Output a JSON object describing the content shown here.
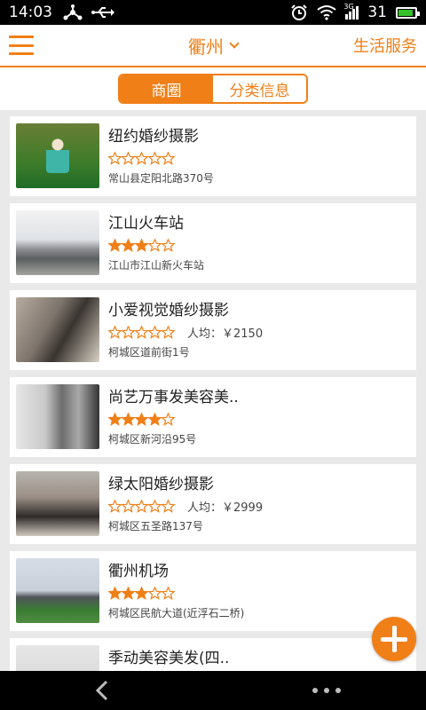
{
  "status_bar": {
    "time": "14:03",
    "signal_label": "3G",
    "battery_level": "31"
  },
  "header": {
    "city": "衢州",
    "right_link": "生活服务"
  },
  "tabs": [
    {
      "label": "商圈",
      "active": true
    },
    {
      "label": "分类信息",
      "active": false
    }
  ],
  "list": [
    {
      "name": "纽约婚纱摄影",
      "rating": 0,
      "avg_price": "",
      "address": "常山县定阳北路370号",
      "thumb": "t1"
    },
    {
      "name": "江山火车站",
      "rating": 3,
      "avg_price": "",
      "address": "江山市江山新火车站",
      "thumb": "t2"
    },
    {
      "name": "小爱视觉婚纱摄影",
      "rating": 0,
      "avg_price": "人均：￥2150",
      "address": "柯城区道前街1号",
      "thumb": "t3"
    },
    {
      "name": "尚艺万事发美容美..",
      "rating": 4,
      "avg_price": "",
      "address": "柯城区新河沿95号",
      "thumb": "t4"
    },
    {
      "name": "绿太阳婚纱摄影",
      "rating": 0,
      "avg_price": "人均：￥2999",
      "address": "柯城区五圣路137号",
      "thumb": "t5"
    },
    {
      "name": "衢州机场",
      "rating": 3,
      "avg_price": "",
      "address": "柯城区民航大道(近浮石二桥)",
      "thumb": "t6"
    },
    {
      "name": "季动美容美发(四..",
      "rating": 0,
      "avg_price": "",
      "address": "",
      "thumb": "t7"
    }
  ],
  "colors": {
    "accent": "#f07f17",
    "background": "#e9e9e9"
  }
}
